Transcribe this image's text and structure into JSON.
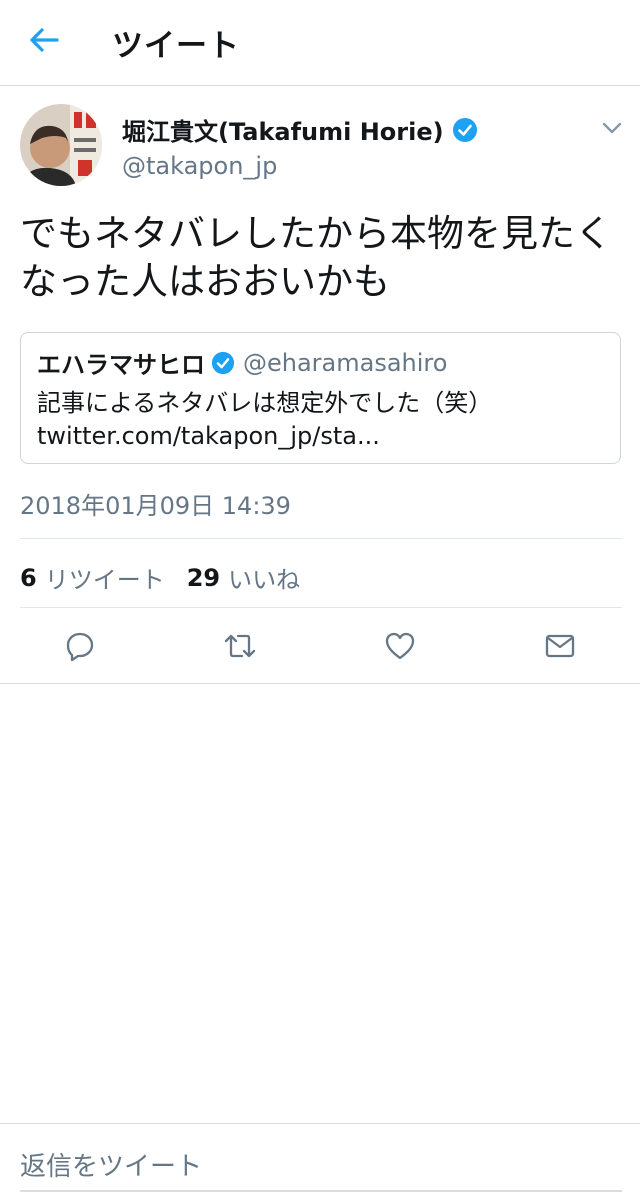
{
  "header": {
    "title": "ツイート"
  },
  "tweet": {
    "author_name": "堀江貴文(Takafumi Horie)",
    "author_handle": "@takapon_jp",
    "text": "でもネタバレしたから本物を見たくなった人はおおいかも",
    "timestamp": "2018年01月09日 14:39"
  },
  "quoted": {
    "name": "エハラマサヒロ",
    "handle": "@eharamasahiro",
    "text": "記事によるネタバレは想定外でした（笑）",
    "link": "twitter.com/takapon_jp/sta..."
  },
  "stats": {
    "retweets_count": "6",
    "retweets_label": "リツイート",
    "likes_count": "29",
    "likes_label": "いいね"
  },
  "reply": {
    "placeholder": "返信をツイート"
  },
  "icons": [
    "back-arrow-icon",
    "verified-badge-icon",
    "chevron-down-icon",
    "reply-icon",
    "retweet-icon",
    "like-icon",
    "dm-icon"
  ],
  "colors": {
    "accent": "#1da1f2",
    "text": "#14171a",
    "secondary": "#657786",
    "border": "#d9dde0"
  }
}
